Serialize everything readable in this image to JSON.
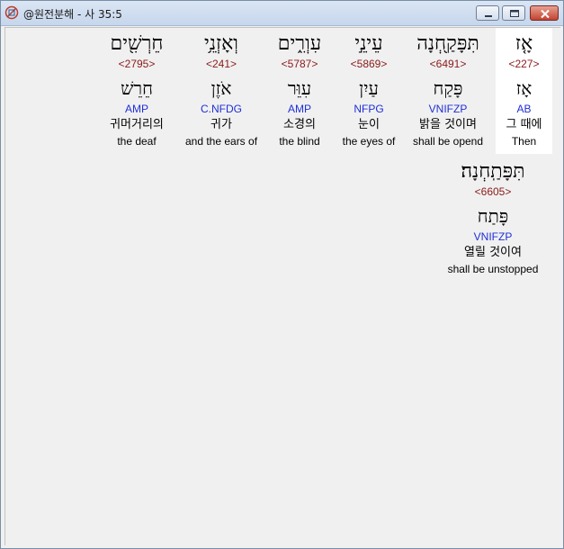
{
  "window": {
    "title": "@원전분해 - 사 35:5",
    "icon": "bible-app-icon",
    "controls": [
      "minimize",
      "maximize",
      "close"
    ],
    "close_color": "#c24431"
  },
  "words": [
    {
      "hebrew": "אָ֤ז",
      "strong": "<227>",
      "root": "אָז",
      "morph": "AB",
      "korean": "그 때에",
      "english": "Then"
    },
    {
      "hebrew": "תִּפָּקַ֖חְנָה",
      "strong": "<6491>",
      "root": "פָּקַח",
      "morph": "VNIFZP",
      "korean": "밝을 것이며",
      "english": "shall be opend"
    },
    {
      "hebrew": "עֵינֵ֣י",
      "strong": "<5869>",
      "root": "עַיִן",
      "morph": "NFPG",
      "korean": "눈이",
      "english": "the eyes of"
    },
    {
      "hebrew": "עִוְרִ֑ים",
      "strong": "<5787>",
      "root": "עִוֵּר",
      "morph": "AMP",
      "korean": "소경의",
      "english": "the blind"
    },
    {
      "hebrew": "וְאָזְנֵ֥י",
      "strong": "<241>",
      "root": "אֹזֶן",
      "morph": "C.NFDG",
      "korean": "귀가",
      "english": "and the ears of"
    },
    {
      "hebrew": "חֵרְשִׁ֖ים",
      "strong": "<2795>",
      "root": "חֵרֵשׁ",
      "morph": "AMP",
      "korean": "귀머거리의",
      "english": "the deaf"
    },
    {
      "hebrew": "תִּפָּתַֽחְנָה׃",
      "strong": "<6605>",
      "root": "פָּתַח",
      "morph": "VNIFZP",
      "korean": "열릴 것이여",
      "english": "shall be unstopped"
    }
  ],
  "colors": {
    "strong": "#8b1a1a",
    "morph": "#1f2fd6",
    "selected_bg": "#ffffff",
    "client_bg": "#f0f0f0"
  }
}
